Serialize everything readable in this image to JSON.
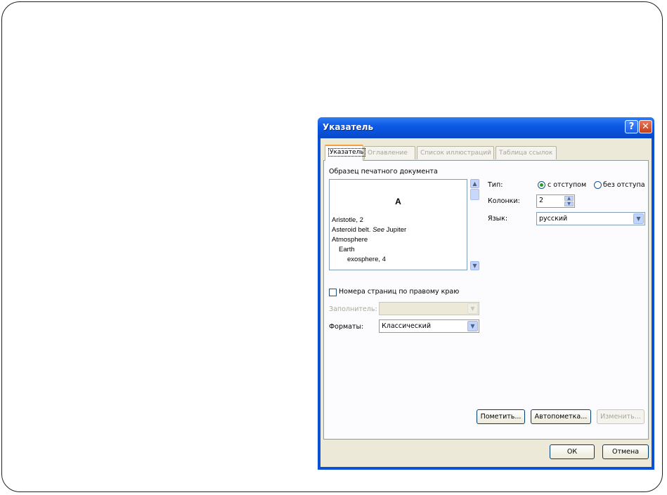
{
  "dialog": {
    "title": "Указатель",
    "help_glyph": "?",
    "close_glyph": "✕"
  },
  "tabs": [
    {
      "label": "Указатель",
      "active": true
    },
    {
      "label": "Оглавление",
      "active": false
    },
    {
      "label": "Список иллюстраций",
      "active": false
    },
    {
      "label": "Таблица ссылок",
      "active": false
    }
  ],
  "preview": {
    "label": "Образец печатного документа",
    "letter": "A",
    "lines": [
      "Aristotle, 2",
      "Asteroid belt.",
      "See",
      "Jupiter",
      "Atmosphere",
      "Earth",
      "exosphere, 4"
    ]
  },
  "type": {
    "label": "Тип:",
    "option_indent": "с отступом",
    "option_no_indent": "без отступа",
    "selected": "с отступом"
  },
  "columns": {
    "label": "Колонки:",
    "value": "2"
  },
  "language": {
    "label": "Язык:",
    "value": "русский"
  },
  "right_align": {
    "label": "Номера страниц по правому краю",
    "checked": false
  },
  "filler": {
    "label": "Заполнитель:",
    "value": ""
  },
  "formats": {
    "label": "Форматы:",
    "value": "Классический"
  },
  "buttons": {
    "mark": "Пометить...",
    "automark": "Автопометка...",
    "modify": "Изменить...",
    "ok": "ОК",
    "cancel": "Отмена"
  },
  "glyphs": {
    "up": "▲",
    "down": "▼",
    "combo": "▼"
  },
  "colors": {
    "title_bar": "#0a51d6",
    "tab_accent": "#f4a13c",
    "dialog_face": "#ece9d8"
  }
}
